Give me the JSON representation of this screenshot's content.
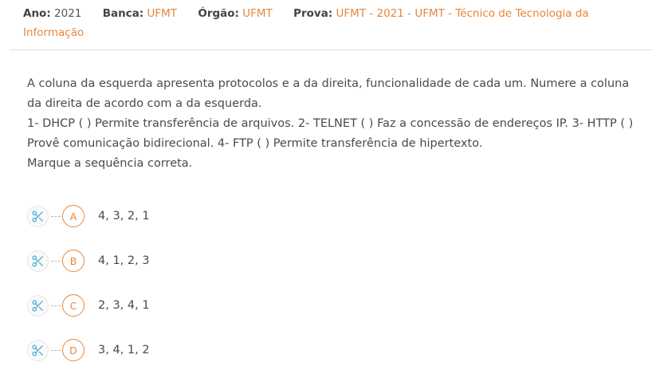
{
  "meta": {
    "ano_label": "Ano:",
    "ano_value": "2021",
    "banca_label": "Banca:",
    "banca_value": "UFMT",
    "orgao_label": "Órgão:",
    "orgao_value": "UFMT",
    "prova_label": "Prova:",
    "prova_value": "UFMT - 2021 - UFMT - Técnico de Tecnologia da Informação"
  },
  "question": {
    "lines": [
      "A coluna da esquerda apresenta protocolos e a da direita, funcionalidade de cada um. Numere a coluna da direita de acordo com a da esquerda.",
      "1- DHCP ( ) Permite transferência de arquivos. 2- TELNET ( ) Faz a concessão de endereços IP. 3- HTTP ( ) Provê comunicação bidirecional. 4- FTP ( ) Permite transferência de hipertexto.",
      "Marque a sequência correta."
    ]
  },
  "alternatives": [
    {
      "letter": "A",
      "text": "4, 3, 2, 1",
      "icon": "scissors-icon"
    },
    {
      "letter": "B",
      "text": "4, 1, 2, 3",
      "icon": "scissors-icon"
    },
    {
      "letter": "C",
      "text": "2, 3, 4, 1",
      "icon": "scissors-icon"
    },
    {
      "letter": "D",
      "text": "3, 4, 1, 2",
      "icon": "scissors-icon"
    }
  ],
  "colors": {
    "accent": "#e8863a",
    "text": "#4a4a4a",
    "scissors": "#5ab4d6"
  }
}
